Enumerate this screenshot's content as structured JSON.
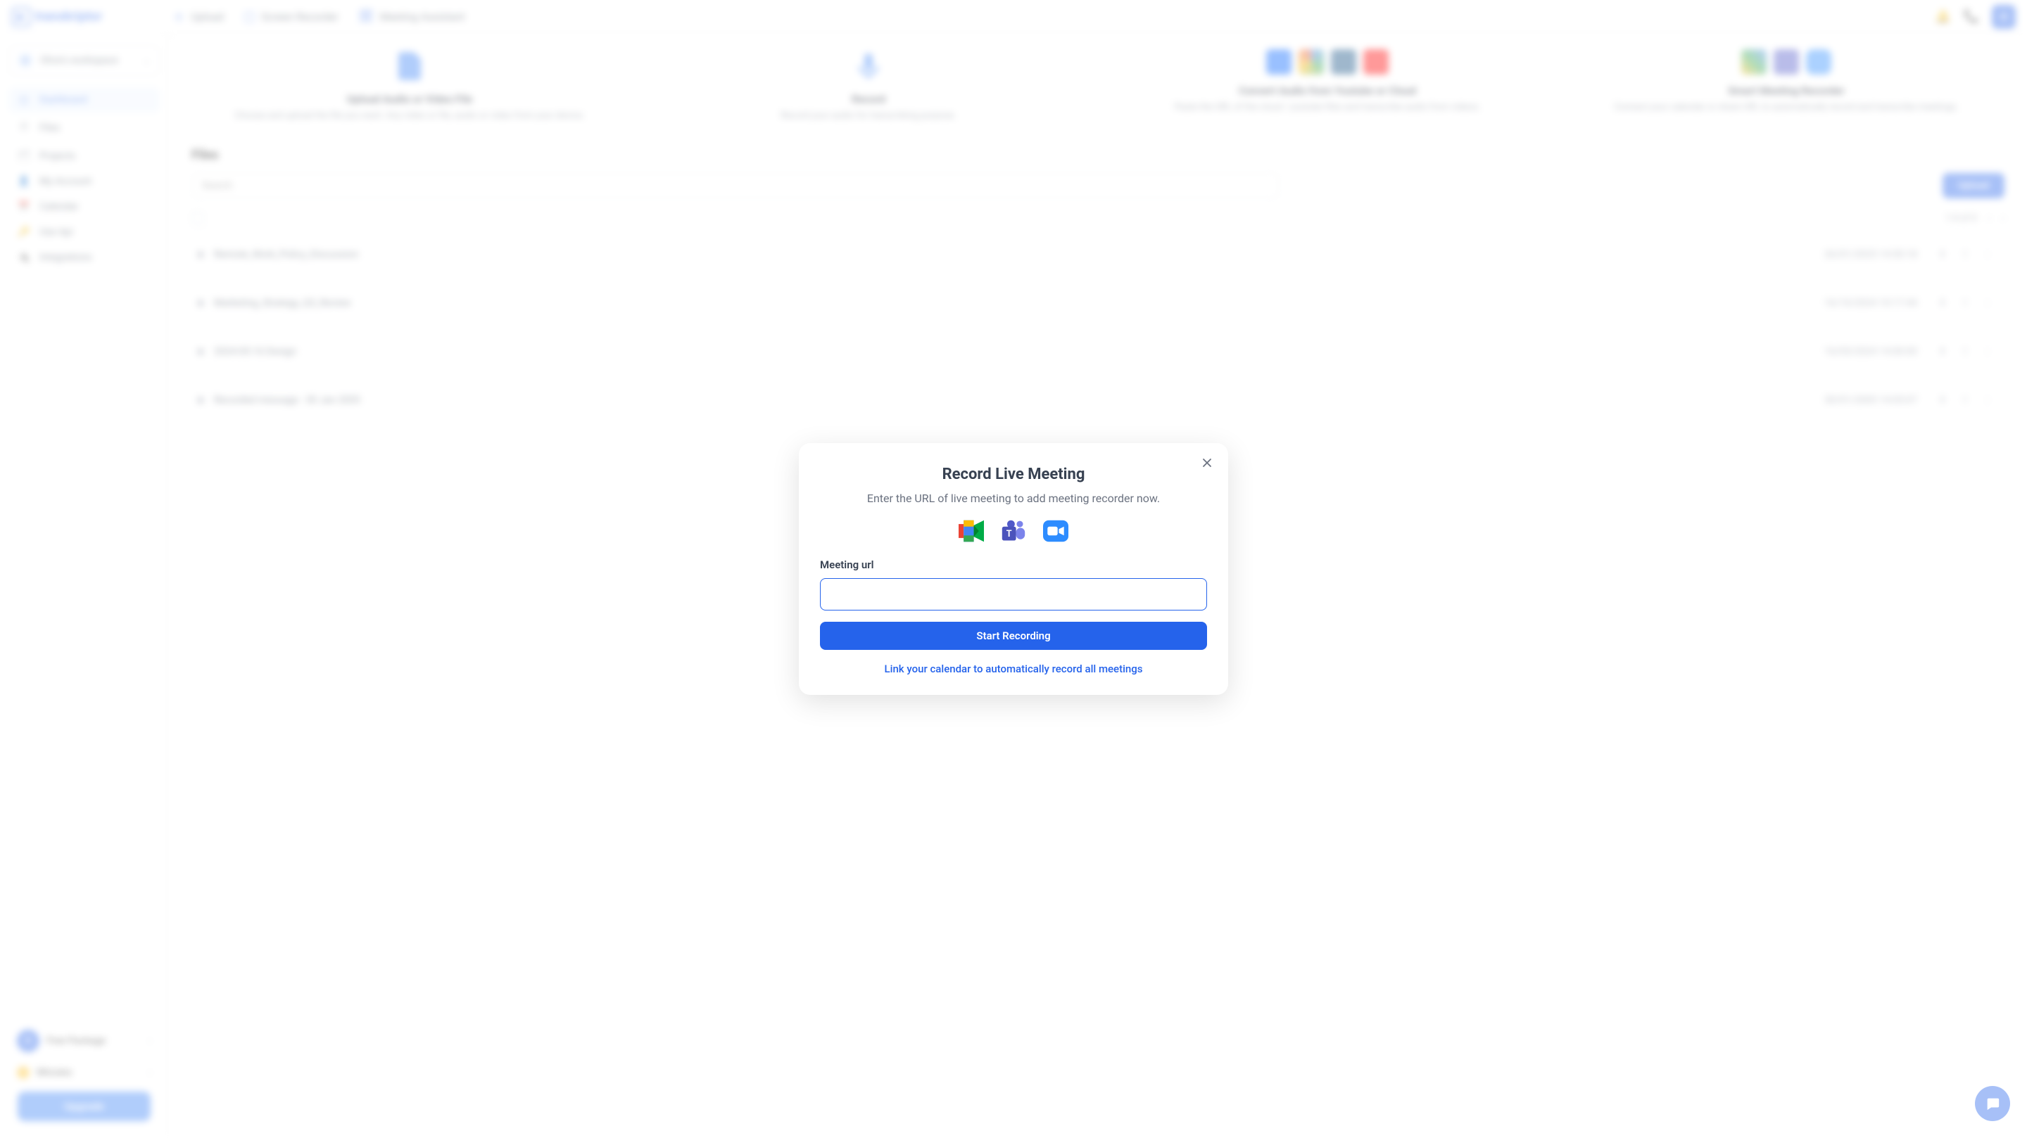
{
  "brand": "transkriptor",
  "header": {
    "nav": [
      {
        "label": "Upload",
        "icon": "plus-icon"
      },
      {
        "label": "Screen Recorder",
        "icon": "screen-icon"
      },
      {
        "label": "Meeting Assistant",
        "icon": "calendar-icon"
      }
    ],
    "avatar_initial": "O"
  },
  "sidebar": {
    "workspace": "Olive's workspace",
    "items": [
      {
        "label": "Dashboard",
        "active": true
      },
      {
        "label": "Files",
        "active": false
      },
      {
        "label": "Projects",
        "active": false
      },
      {
        "label": "My Account",
        "active": false
      },
      {
        "label": "Calendar",
        "active": false
      },
      {
        "label": "Use Api",
        "active": false
      },
      {
        "label": "Integrations",
        "active": false
      }
    ],
    "user": {
      "initial": "O",
      "name": "Free Package"
    },
    "minutes_label": "Minutes",
    "upgrade_label": "Upgrade"
  },
  "cards": [
    {
      "title": "Upload Audio or Video File",
      "desc": "Choose and upload the file you want. Any video or file, audio or video from your device."
    },
    {
      "title": "Record",
      "desc": "Record your audio for transcribing purpose."
    },
    {
      "title": "Convert Audio from Youtube or Cloud",
      "desc": "Paste the URL of the cloud / youtube files and transcribe audio from videos."
    },
    {
      "title": "Smart Meeting Recorder",
      "desc": "Connect your calendar or share URL to automatically record and transcribe meetings."
    }
  ],
  "files": {
    "heading": "Files",
    "search_placeholder": "Search",
    "upload_label": "Upload",
    "page_info": "1-4 of 4",
    "rows": [
      {
        "name": "Remote_Work_Policy_Discussion",
        "date": "26/01/2025 14:50:18"
      },
      {
        "name": "Marketing_Strategy_Q3_Review",
        "date": "16/10/2024 10:17:44"
      },
      {
        "name": "2024-05-16 Design",
        "date": "16/05/2024 14:00:00"
      },
      {
        "name": "Recorded message - 30 Jan 2005",
        "date": "30/01/2005 14:05:07"
      }
    ]
  },
  "modal": {
    "title": "Record Live Meeting",
    "subtitle": "Enter the URL of live meeting to add meeting recorder now.",
    "field_label": "Meeting url",
    "input_value": "",
    "button_label": "Start Recording",
    "link_label": "Link your calendar to automatically record all meetings"
  }
}
